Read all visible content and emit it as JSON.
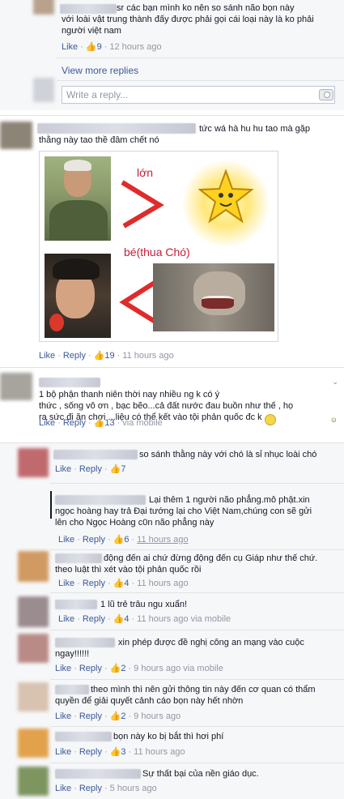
{
  "top_reply": {
    "text": "sr các bạn mình ko nên so sánh não bọn này\nvới loài vật trung thành đấy được phải gọi cái loại này là ko phải\nngười việt nam",
    "like": "Like",
    "likes": "9",
    "time": "12 hours ago"
  },
  "view_more_replies": "View more replies",
  "reply_placeholder": "Write a reply...",
  "comment_image_post": {
    "text": "tức wá hà hu hu tao mà gặp\nthằng này tao thề đâm chết nó",
    "image_labels": {
      "greater": "lớn",
      "lesser": "bé(thua Chó)"
    },
    "like": "Like",
    "reply": "Reply",
    "likes": "19",
    "time": "11 hours ago"
  },
  "comment_thanh_nien": {
    "text": "1 bộ phận thanh niên thời nay nhiều ng k có ý\nthức , sống vô ơn , bạc bẽo...cả đất nước đau buồn như thế , họ\nra sức đi ăn chơi ...liệu có thể kết vào tội phản quốc đc k",
    "like": "Like",
    "reply": "Reply",
    "likes": "13",
    "via": "via mobile"
  },
  "comments": [
    {
      "text": "so sánh thằng này với chó là sỉ nhục loài chó",
      "like": "Like",
      "reply": "Reply",
      "likes": "7",
      "time": ""
    },
    {
      "text": "Lại thêm 1 người não phẳng.mô phật.xin\nngọc hoàng hay trả Đại tướng lại cho Việt Nam,chúng con sẽ gửi\nlên cho Ngọc Hoàng c0n não phẳng này",
      "like": "Like",
      "reply": "Reply",
      "likes": "6",
      "time": "11 hours ago"
    },
    {
      "text": "động đến ai chứ đừng động đến cụ Giáp như thế chứ.\ntheo luật thì xét vào tội phản quốc rồi",
      "like": "Like",
      "reply": "Reply",
      "likes": "4",
      "time": "11 hours ago"
    },
    {
      "text": "1 lũ trẻ trâu ngu xuẩn!",
      "like": "Like",
      "reply": "Reply",
      "likes": "4",
      "time": "11 hours ago via mobile"
    },
    {
      "text": "xin phép được đề nghị công an mạng vào cuộc\nngay!!!!!!",
      "like": "Like",
      "reply": "Reply",
      "likes": "2",
      "time": "9 hours ago via mobile"
    },
    {
      "text": "theo mình thì nên gửi thông tin này đến cơ quan có thẩm\nquyền để giải quyết cảnh cáo bọn này hết nhờn",
      "like": "Like",
      "reply": "Reply",
      "likes": "2",
      "time": "9 hours ago"
    },
    {
      "text": "bọn này ko bị bắt thì hơi phí",
      "like": "Like",
      "reply": "Reply",
      "likes": "3",
      "time": "11 hours ago"
    },
    {
      "text": "Sự thất bại của nền giáo dục.",
      "like": "Like",
      "reply": "Reply",
      "likes": "",
      "time": "5 hours ago"
    }
  ],
  "colors": {
    "link": "#3b5998",
    "meta": "#9197a3",
    "reply_bg": "#f6f7f9"
  },
  "icons": [
    "thumbs-up-icon",
    "camera-icon",
    "chevron-down-icon",
    "smiley-icon"
  ]
}
